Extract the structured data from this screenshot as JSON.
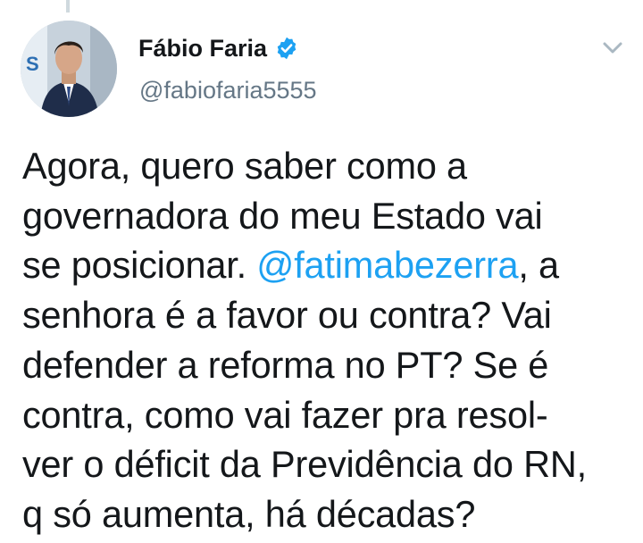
{
  "tweet": {
    "author": {
      "display_name": "Fábio Faria",
      "handle": "@fabiofaria5555",
      "verified": true,
      "avatar_icon": "profile-photo"
    },
    "text_lines": {
      "l1": "Agora, quero saber como a",
      "l2": "governadora do meu Estado vai",
      "l3_before": "se posicionar. ",
      "l3_mention": "@fatimabezerra",
      "l3_after": ", a",
      "l4": "senhora é a favor ou contra? Vai",
      "l5": "defender a reforma no PT? Se é",
      "l6": "contra, como vai fazer pra resol-",
      "l7": "ver o déficit da Previdência do RN,",
      "l8": "q só aumenta, há décadas?"
    },
    "icons": {
      "verified": "verified-badge-icon",
      "menu": "chevron-down-icon"
    },
    "colors": {
      "text": "#14171a",
      "handle": "#657786",
      "link": "#1da1f2",
      "verified": "#1da1f2",
      "chevron": "#aab8c2"
    }
  }
}
